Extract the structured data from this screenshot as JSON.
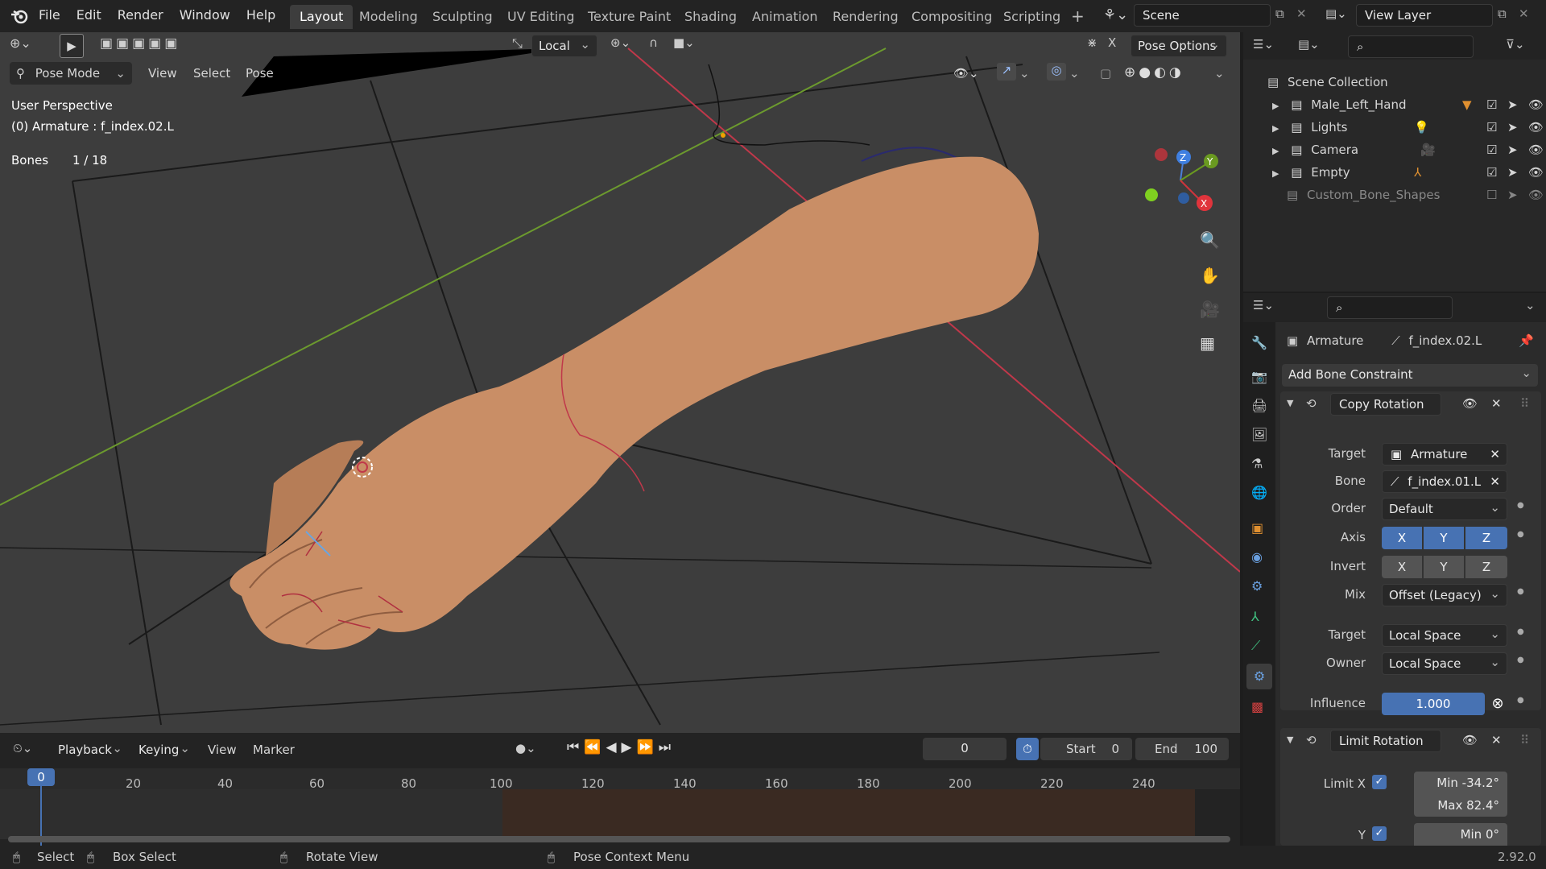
{
  "menu": {
    "items": [
      "File",
      "Edit",
      "Render",
      "Window",
      "Help"
    ]
  },
  "workspaces": [
    "Layout",
    "Modeling",
    "Sculpting",
    "UV Editing",
    "Texture Paint",
    "Shading",
    "Animation",
    "Rendering",
    "Compositing",
    "Scripting"
  ],
  "scene": {
    "name": "Scene",
    "view_layer": "View Layer"
  },
  "viewport": {
    "transform_orientation": "Local",
    "pose_options": "Pose Options",
    "mode": "Pose Mode",
    "menus": [
      "View",
      "Select",
      "Pose"
    ],
    "perspective": "User Perspective",
    "object_info": "(0) Armature : f_index.02.L",
    "bones_label": "Bones",
    "bones_value": "1 / 18"
  },
  "outliner": {
    "root": "Scene Collection",
    "items": [
      "Male_Left_Hand",
      "Lights",
      "Camera",
      "Empty",
      "Custom_Bone_Shapes"
    ]
  },
  "properties": {
    "breadcrumb_object": "Armature",
    "breadcrumb_bone": "f_index.02.L",
    "add_constraint": "Add Bone Constraint",
    "copy_rotation": {
      "title": "Copy Rotation",
      "target_label": "Target",
      "target": "Armature",
      "bone_label": "Bone",
      "bone": "f_index.01.L",
      "order_label": "Order",
      "order": "Default",
      "axis_label": "Axis",
      "invert_label": "Invert",
      "x": "X",
      "y": "Y",
      "z": "Z",
      "mix_label": "Mix",
      "mix": "Offset (Legacy)",
      "target_space_label": "Target",
      "target_space": "Local Space",
      "owner_label": "Owner",
      "owner_space": "Local Space",
      "influence_label": "Influence",
      "influence": "1.000"
    },
    "limit_rotation": {
      "title": "Limit Rotation",
      "limit_x_label": "Limit X",
      "min_x": "Min  -34.2°",
      "max_x": "Max  82.4°",
      "y_label": "Y",
      "min_y": "Min  0°"
    }
  },
  "timeline": {
    "menus": [
      "Playback",
      "Keying",
      "View",
      "Marker"
    ],
    "current_frame": "0",
    "start_label": "Start",
    "start": "0",
    "end_label": "End",
    "end": "100",
    "ticks": [
      "0",
      "20",
      "40",
      "60",
      "80",
      "100",
      "120",
      "140",
      "160",
      "180",
      "200",
      "220",
      "240"
    ]
  },
  "status": {
    "select": "Select",
    "box_select": "Box Select",
    "rotate_view": "Rotate View",
    "context_menu": "Pose Context Menu",
    "version": "2.92.0"
  }
}
